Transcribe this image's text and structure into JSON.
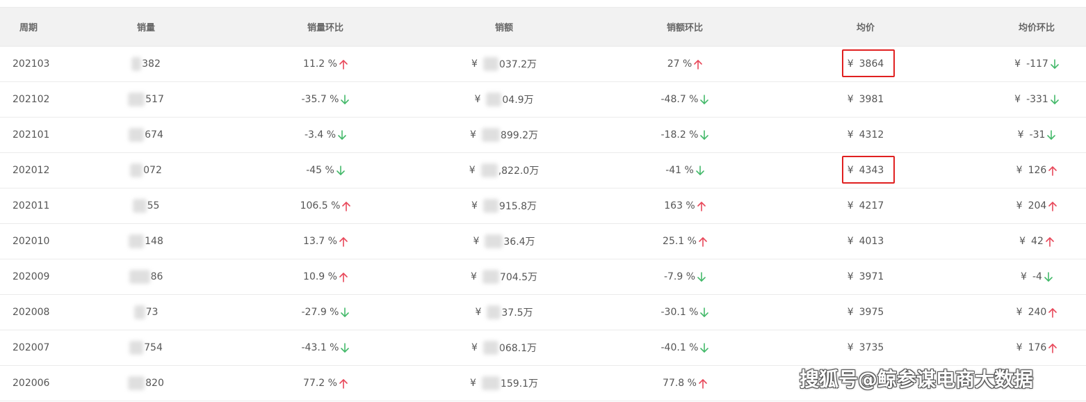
{
  "colors": {
    "up": "#e8485a",
    "down": "#44b96a",
    "highlight": "#e02020"
  },
  "header": {
    "period": "周期",
    "sales_volume": "销量",
    "volume_mom": "销量环比",
    "sales_amount": "销额",
    "amount_mom": "销额环比",
    "avg_price": "均价",
    "price_mom": "均价环比"
  },
  "currency": "¥",
  "rows": [
    {
      "period": "202103",
      "volume": "382",
      "volume_mom": "11.2 %",
      "volume_dir": "up",
      "amount": "037.2万",
      "amount_mom": "27 %",
      "amount_dir": "up",
      "price": "3864",
      "price_mom": "-117",
      "price_dir": "down",
      "highlighted": true
    },
    {
      "period": "202102",
      "volume": "517",
      "volume_mom": "-35.7 %",
      "volume_dir": "down",
      "amount": "04.9万",
      "amount_mom": "-48.7 %",
      "amount_dir": "down",
      "price": "3981",
      "price_mom": "-331",
      "price_dir": "down",
      "highlighted": false
    },
    {
      "period": "202101",
      "volume": "674",
      "volume_mom": "-3.4 %",
      "volume_dir": "down",
      "amount": "899.2万",
      "amount_mom": "-18.2 %",
      "amount_dir": "down",
      "price": "4312",
      "price_mom": "-31",
      "price_dir": "down",
      "highlighted": false
    },
    {
      "period": "202012",
      "volume": "072",
      "volume_mom": "-45 %",
      "volume_dir": "down",
      "amount": ",822.0万",
      "amount_mom": "-41 %",
      "amount_dir": "down",
      "price": "4343",
      "price_mom": "126",
      "price_dir": "up",
      "highlighted": true
    },
    {
      "period": "202011",
      "volume": "55",
      "volume_mom": "106.5 %",
      "volume_dir": "up",
      "amount": "915.8万",
      "amount_mom": "163 %",
      "amount_dir": "up",
      "price": "4217",
      "price_mom": "204",
      "price_dir": "up",
      "highlighted": false
    },
    {
      "period": "202010",
      "volume": "148",
      "volume_mom": "13.7 %",
      "volume_dir": "up",
      "amount": "36.4万",
      "amount_mom": "25.1 %",
      "amount_dir": "up",
      "price": "4013",
      "price_mom": "42",
      "price_dir": "up",
      "highlighted": false
    },
    {
      "period": "202009",
      "volume": "86",
      "volume_mom": "10.9 %",
      "volume_dir": "up",
      "amount": "704.5万",
      "amount_mom": "-7.9 %",
      "amount_dir": "down",
      "price": "3971",
      "price_mom": "-4",
      "price_dir": "down",
      "highlighted": false
    },
    {
      "period": "202008",
      "volume": "73",
      "volume_mom": "-27.9 %",
      "volume_dir": "down",
      "amount": "37.5万",
      "amount_mom": "-30.1 %",
      "amount_dir": "down",
      "price": "3975",
      "price_mom": "240",
      "price_dir": "up",
      "highlighted": false
    },
    {
      "period": "202007",
      "volume": "754",
      "volume_mom": "-43.1 %",
      "volume_dir": "down",
      "amount": "068.1万",
      "amount_mom": "-40.1 %",
      "amount_dir": "down",
      "price": "3735",
      "price_mom": "176",
      "price_dir": "up",
      "highlighted": false
    },
    {
      "period": "202006",
      "volume": "820",
      "volume_mom": "77.2 %",
      "volume_dir": "up",
      "amount": "159.1万",
      "amount_mom": "77.8 %",
      "amount_dir": "up",
      "price": "",
      "price_mom": "",
      "price_dir": "",
      "highlighted": false
    }
  ],
  "watermark": "搜狐号@鲸参谋电商大数据"
}
